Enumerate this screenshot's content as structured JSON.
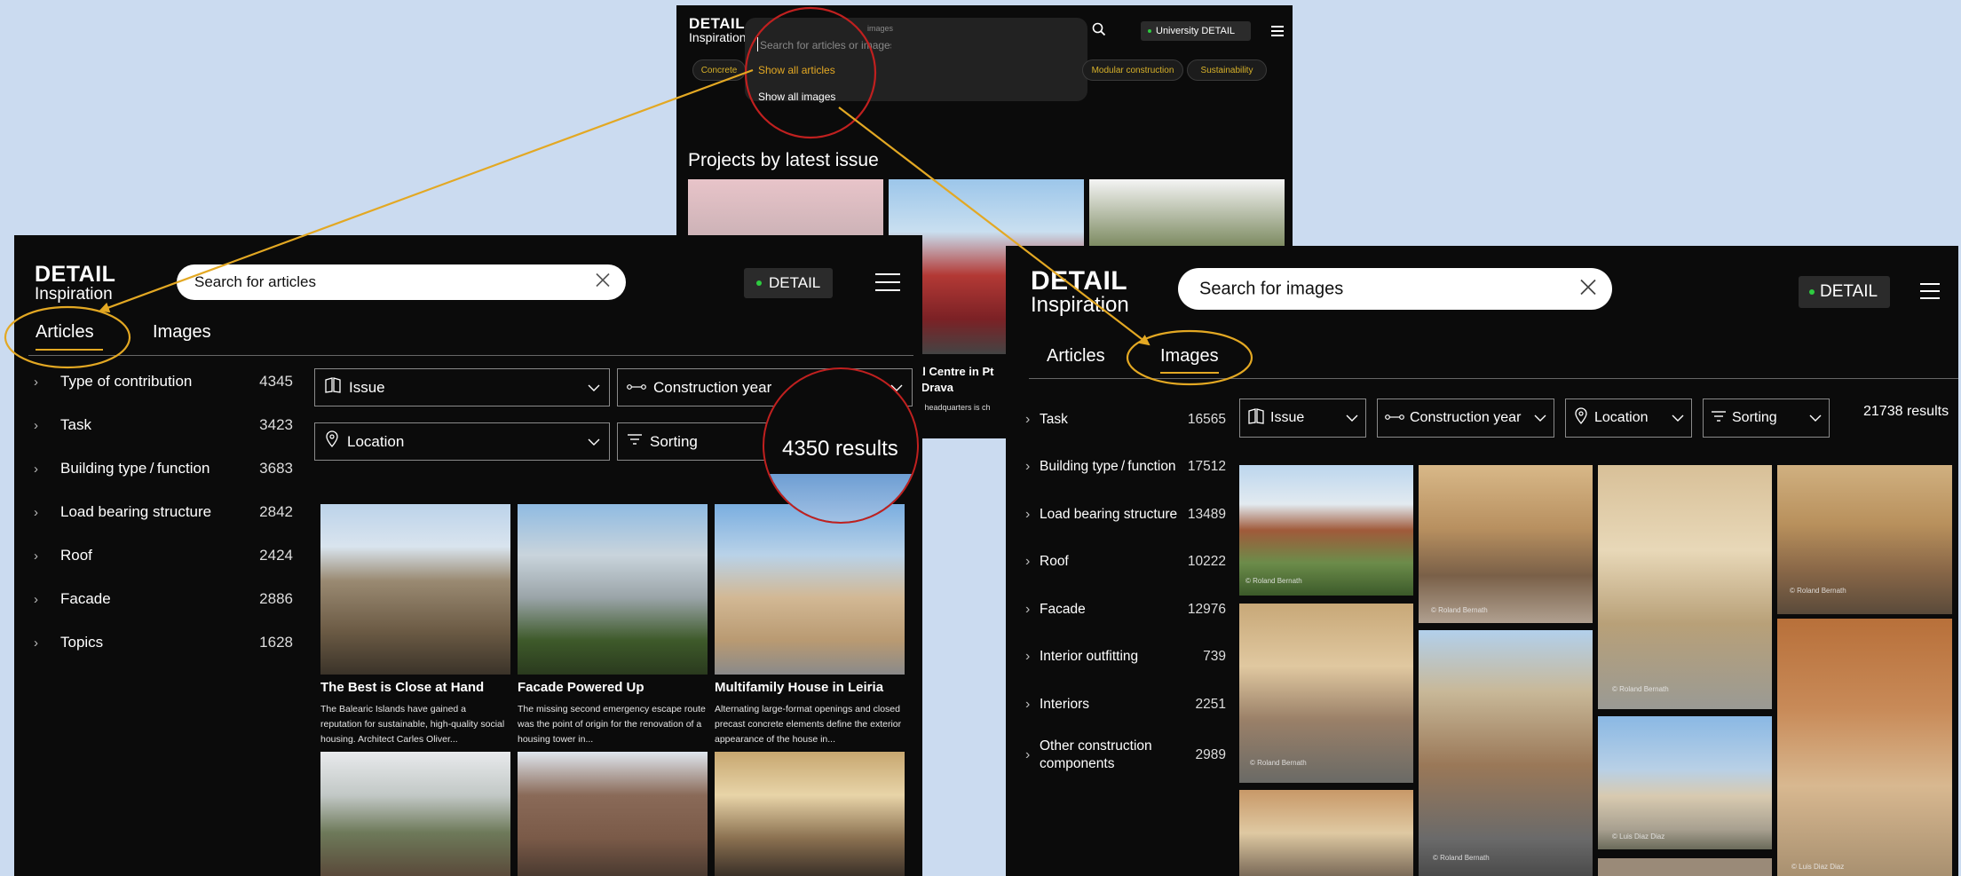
{
  "colors": {
    "background": "#cbdbf0",
    "panel": "#0b0b0b",
    "accent_yellow": "#e3a823",
    "highlight_red": "#c0201f",
    "status_green": "#2ecc40"
  },
  "top_panel": {
    "logo": {
      "line1": "DETAIL",
      "line2": "Inspiration"
    },
    "search_placeholder": "Search for articles or images",
    "search_hint": "images",
    "account_label": "University DETAIL",
    "menu_options": [
      "Show all articles",
      "Show all images"
    ],
    "tags": [
      "Concrete",
      "Modular construction",
      "Sustainability"
    ],
    "section_title": "Projects by latest issue",
    "peek_title_line1": "ral Centre in Pt",
    "peek_title_line2": "e Drava",
    "peek_desc": "afit headquarters is ch"
  },
  "articles_panel": {
    "logo": {
      "line1": "DETAIL",
      "line2": "Inspiration"
    },
    "search_value": "Search for articles",
    "account_label": "DETAIL",
    "tabs": [
      {
        "label": "Articles",
        "active": true
      },
      {
        "label": "Images",
        "active": false
      }
    ],
    "filters": [
      {
        "label": "Type of contribution",
        "count": "4345"
      },
      {
        "label": "Task",
        "count": "3423"
      },
      {
        "label": "Building type / function",
        "count": "3683"
      },
      {
        "label": "Load bearing structure",
        "count": "2842"
      },
      {
        "label": "Roof",
        "count": "2424"
      },
      {
        "label": "Facade",
        "count": "2886"
      },
      {
        "label": "Topics",
        "count": "1628"
      }
    ],
    "dropdowns": {
      "issue": "Issue",
      "construction_year": "Construction year",
      "location": "Location",
      "sorting": "Sorting"
    },
    "results": "4350 results",
    "cards": [
      {
        "title": "The Best is Close at Hand",
        "desc": "The Balearic Islands have gained a reputation for sustainable, high-quality social housing. Architect Carles Oliver..."
      },
      {
        "title": "Facade Powered Up",
        "desc": "The missing second emergency escape route was the point of origin for the renovation of a housing tower in..."
      },
      {
        "title": "Multifamily House in Leiria",
        "desc": "Alternating large-format openings and closed precast concrete elements define the exterior appearance of the house in..."
      }
    ]
  },
  "images_panel": {
    "logo": {
      "line1": "DETAIL",
      "line2": "Inspiration"
    },
    "search_value": "Search for images",
    "account_label": "DETAIL",
    "tabs": [
      {
        "label": "Articles",
        "active": false
      },
      {
        "label": "Images",
        "active": true
      }
    ],
    "filters": [
      {
        "label": "Task",
        "count": "16565"
      },
      {
        "label": "Building type / function",
        "count": "17512"
      },
      {
        "label": "Load bearing structure",
        "count": "13489"
      },
      {
        "label": "Roof",
        "count": "10222"
      },
      {
        "label": "Facade",
        "count": "12976"
      },
      {
        "label": "Interior outfitting",
        "count": "739"
      },
      {
        "label": "Interiors",
        "count": "2251"
      },
      {
        "label": "Other construction components",
        "count": "2989"
      }
    ],
    "dropdowns": {
      "issue": "Issue",
      "construction_year": "Construction year",
      "location": "Location",
      "sorting": "Sorting"
    },
    "results": "21738 results",
    "credits": [
      "© Roland Bernath",
      "© Roland Bernath",
      "© Roland Bernath",
      "© Roland Bernath",
      "© Roland Bernath",
      "© Roland Bernath",
      "© Luis Diaz Diaz",
      "© Luis Diaz Diaz"
    ]
  }
}
